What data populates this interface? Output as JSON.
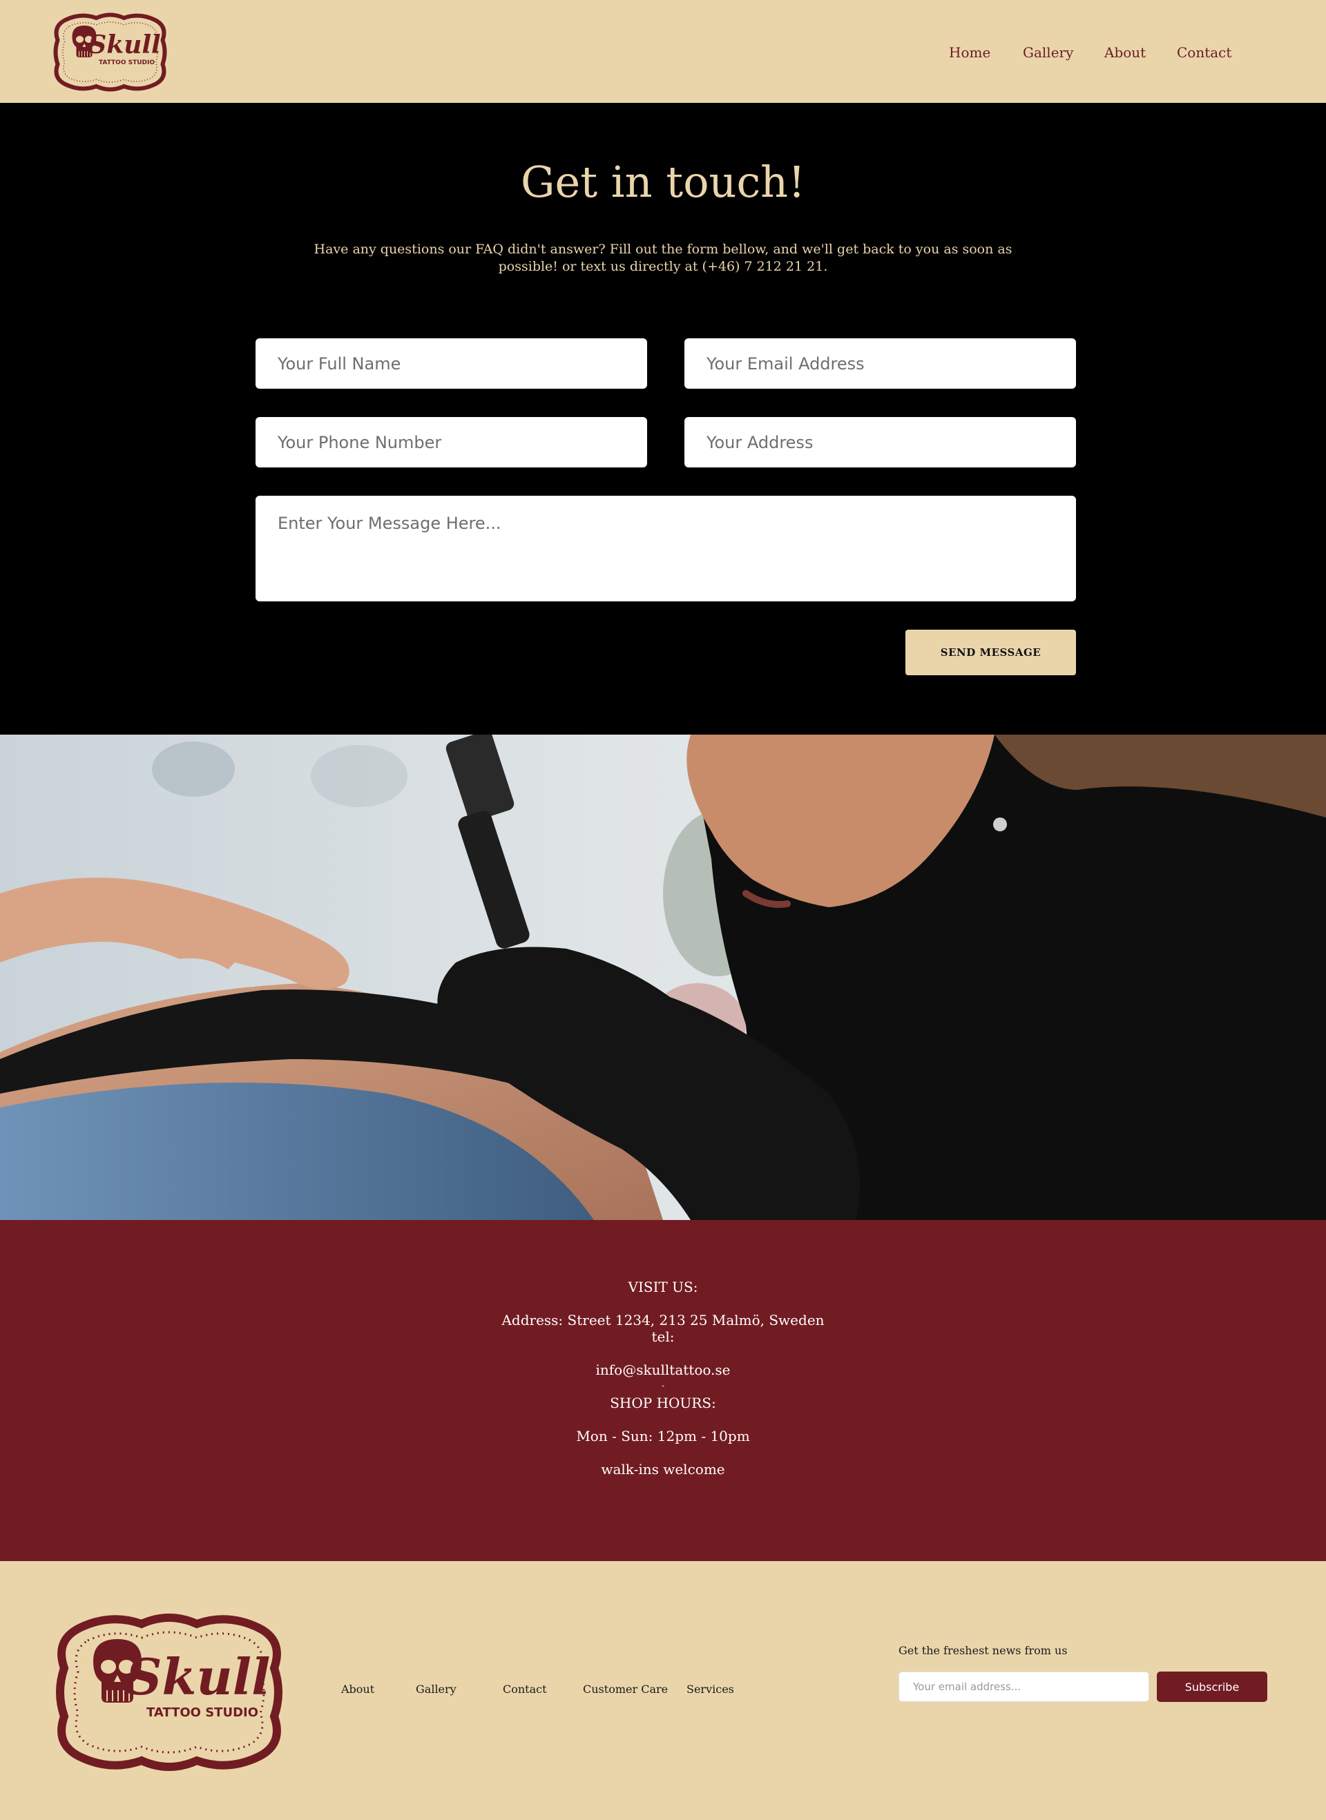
{
  "header": {
    "logo": {
      "name": "Skull",
      "subtitle": "TATTOO STUDIO"
    },
    "nav": [
      {
        "label": "Home"
      },
      {
        "label": "Gallery"
      },
      {
        "label": "About"
      },
      {
        "label": "Contact"
      }
    ]
  },
  "contact": {
    "title": "Get in touch!",
    "intro": "Have any questions our FAQ didn't answer? Fill out the form bellow, and we'll get back to you as soon as possible! or text us directly at  (+46) 7 212 21 21.",
    "form": {
      "full_name_placeholder": "Your Full Name",
      "email_placeholder": "Your Email Address",
      "phone_placeholder": "Your Phone Number",
      "address_placeholder": "Your Address",
      "message_placeholder": "Enter Your Message Here...",
      "submit_label": "SEND MESSAGE"
    }
  },
  "visit": {
    "heading": "VISIT US:",
    "address": "Address: Street 1234, 213 25 Malmö, Sweden",
    "tel": "tel:",
    "email": "info@skulltattoo.se",
    "separator": "-",
    "hours_heading": "SHOP HOURS:",
    "hours": "Mon - Sun: 12pm - 10pm",
    "walkins": "walk-ins welcome"
  },
  "footer": {
    "logo": {
      "name": "Skull",
      "subtitle": "TATTOO STUDIO"
    },
    "links": [
      {
        "label": "About"
      },
      {
        "label": "Gallery"
      },
      {
        "label": "Contact"
      },
      {
        "label": "Customer Care"
      },
      {
        "label": "Services"
      }
    ],
    "newsletter": {
      "label": "Get the freshest news from us",
      "placeholder": "Your email address...",
      "button": "Subscribe"
    }
  },
  "colors": {
    "beige": "#ead5ab",
    "maroon": "#711c22",
    "black": "#000000"
  }
}
